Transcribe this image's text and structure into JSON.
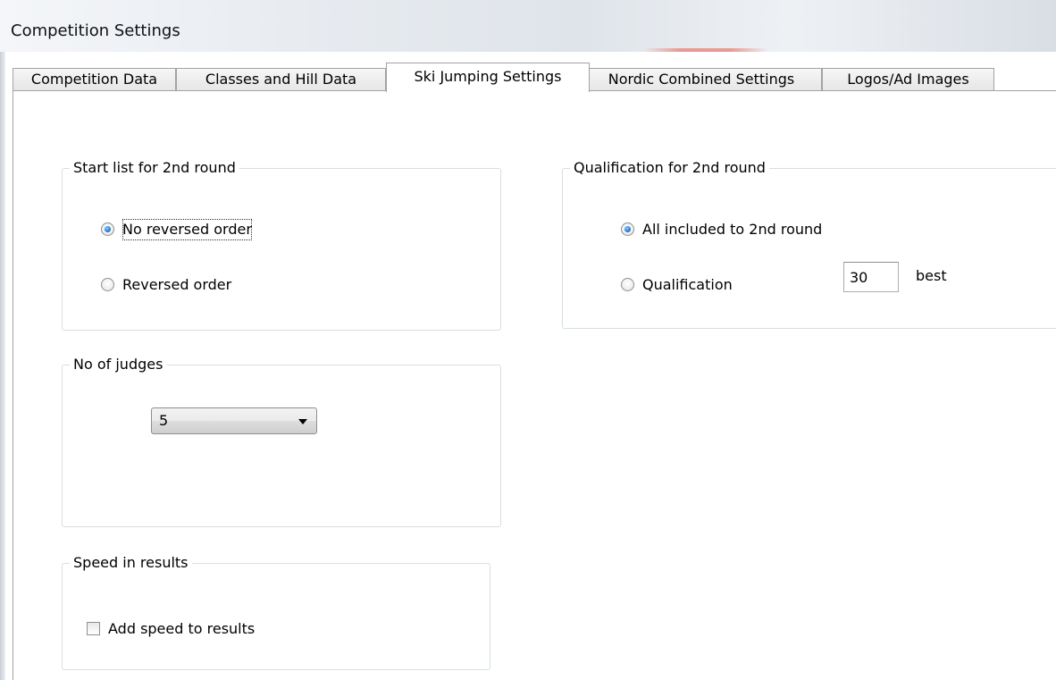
{
  "window": {
    "title": "Competition Settings"
  },
  "tabs": [
    {
      "label": "Competition Data",
      "active": false
    },
    {
      "label": "Classes and Hill Data",
      "active": false
    },
    {
      "label": "Ski Jumping Settings",
      "active": true
    },
    {
      "label": "Nordic Combined Settings",
      "active": false
    },
    {
      "label": "Logos/Ad Images",
      "active": false
    }
  ],
  "start_list": {
    "legend": "Start list for 2nd round",
    "options": [
      {
        "label": "No reversed order",
        "checked": true
      },
      {
        "label": "Reversed order",
        "checked": false
      }
    ]
  },
  "judges": {
    "legend": "No of judges",
    "selected": "5"
  },
  "speed": {
    "legend": "Speed in results",
    "checkbox_label": "Add speed to results",
    "checked": false
  },
  "qualification": {
    "legend": "Qualification for 2nd round",
    "options": [
      {
        "label": "All included to 2nd round",
        "checked": true
      },
      {
        "label": "Qualification",
        "checked": false
      }
    ],
    "count_value": "30",
    "suffix": "best"
  },
  "colors": {
    "groupbox_border": "#d5dfe5",
    "tab_border": "#a3a3a3",
    "radio_accent": "#2a7fd4"
  }
}
